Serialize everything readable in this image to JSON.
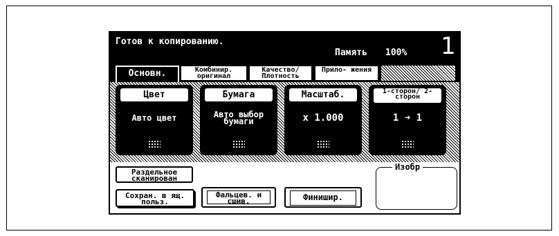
{
  "status": {
    "message": "Готов к копированию.",
    "memory_label": "Память",
    "memory_value": "100%",
    "copies": "1"
  },
  "tabs": [
    {
      "label": "Основн.",
      "active": true
    },
    {
      "label": "Комбинир. оригинал",
      "active": false
    },
    {
      "label": "Качество/ Плотность",
      "active": false
    },
    {
      "label": "Прило- жения",
      "active": false
    }
  ],
  "functions": {
    "color": {
      "title": "Цвет",
      "value": "Авто цвет"
    },
    "paper": {
      "title": "Бумага",
      "value": "Авто выбор бумаги"
    },
    "zoom": {
      "title": "Масштаб.",
      "value": "x 1.000"
    },
    "duplex": {
      "title": "1-сторон/ 2-сторон",
      "value": "1 ➜ 1"
    }
  },
  "buttons": {
    "separate_scan": "Раздельное сканирован",
    "save_box": "Сохран. в ящ. польз.",
    "fold_bind": "Фальцев. и сшив.",
    "finishing": "Финишир."
  },
  "image_panel": {
    "label": "Изобр"
  }
}
